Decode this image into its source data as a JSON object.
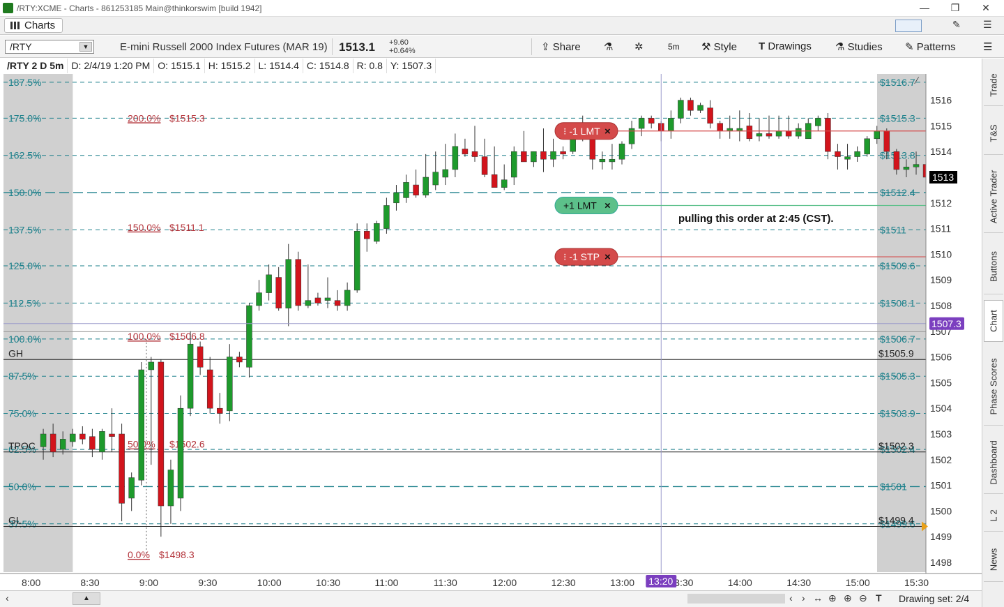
{
  "window": {
    "title": "/RTY:XCME - Charts - 861253185 Main@thinkorswim [build 1942]",
    "minimize": "—",
    "restore": "❐",
    "close": "✕"
  },
  "tabrow": {
    "tab_label": "Charts",
    "pin": "✎",
    "menu": "☰"
  },
  "toolbar": {
    "symbol": "/RTY",
    "description": "E-mini Russell 2000 Index Futures (MAR 19)",
    "last_price": "1513.1",
    "change": "+9.60",
    "change_pct": "+0.64%",
    "share": "Share",
    "aggregation": "5m",
    "style": "Style",
    "drawings": "Drawings",
    "studies": "Studies",
    "patterns": "Patterns"
  },
  "infoline": {
    "symbol": "/RTY 2 D 5m",
    "date": "D: 2/4/19 1:20 PM",
    "open": "O: 1515.1",
    "high": "H: 1515.2",
    "low": "L: 1514.4",
    "close": "C: 1514.8",
    "range": "R: 0.8",
    "ycursor": "Y: 1507.3"
  },
  "sidebar": {
    "tabs": [
      "Trade",
      "T&S",
      "Active Trader",
      "Buttons",
      "Chart",
      "Phase Scores",
      "Dashboard",
      "L 2",
      "News"
    ],
    "active": "Chart"
  },
  "bottombar": {
    "drawing_set": "Drawing set: 2/4"
  },
  "colors": {
    "up": "#1e9a2c",
    "down": "#d2141c",
    "fib": "#1a7f8a",
    "fibtxt": "#b3333a",
    "order_red": "#d44a4a",
    "order_green": "#5cc08a",
    "cursor_badge": "#7b3fbf"
  },
  "chart_data": {
    "type": "candlestick",
    "title": "",
    "x_ticks": [
      "8:00",
      "8:30",
      "9:00",
      "9:30",
      "10:00",
      "10:30",
      "11:00",
      "11:30",
      "12:00",
      "12:30",
      "13:00",
      "13:30",
      "14:00",
      "14:30",
      "15:00",
      "15:30"
    ],
    "y_ticks": [
      1498,
      1499,
      1500,
      1501,
      1502,
      1503,
      1504,
      1505,
      1506,
      1507,
      1508,
      1509,
      1510,
      1511,
      1512,
      1513,
      1514,
      1515,
      1516
    ],
    "ylim": [
      1497.6,
      1516.6
    ],
    "last_price_badge": "1513",
    "cursor_price_badge": "1507.3",
    "cursor_time_badge": "13:20",
    "cursor_time_minutes": 800,
    "cursor_price": 1507.3,
    "candles": [
      {
        "t": 485,
        "o": 1502.5,
        "h": 1503.2,
        "l": 1502.0,
        "c": 1503.0
      },
      {
        "t": 490,
        "o": 1503.0,
        "h": 1503.4,
        "l": 1502.1,
        "c": 1502.3
      },
      {
        "t": 495,
        "o": 1502.4,
        "h": 1503.1,
        "l": 1502.2,
        "c": 1502.8
      },
      {
        "t": 500,
        "o": 1502.7,
        "h": 1503.2,
        "l": 1502.5,
        "c": 1503.0
      },
      {
        "t": 505,
        "o": 1503.0,
        "h": 1503.3,
        "l": 1502.6,
        "c": 1502.8
      },
      {
        "t": 510,
        "o": 1502.9,
        "h": 1503.2,
        "l": 1502.1,
        "c": 1502.4
      },
      {
        "t": 515,
        "o": 1502.3,
        "h": 1503.2,
        "l": 1502.0,
        "c": 1503.1
      },
      {
        "t": 520,
        "o": 1503.0,
        "h": 1504.0,
        "l": 1502.3,
        "c": 1502.9
      },
      {
        "t": 525,
        "o": 1503.0,
        "h": 1503.4,
        "l": 1499.6,
        "c": 1500.3
      },
      {
        "t": 530,
        "o": 1500.5,
        "h": 1501.5,
        "l": 1500.0,
        "c": 1501.3
      },
      {
        "t": 535,
        "o": 1501.2,
        "h": 1505.8,
        "l": 1501.0,
        "c": 1505.5
      },
      {
        "t": 540,
        "o": 1505.5,
        "h": 1506.0,
        "l": 1501.8,
        "c": 1505.8
      },
      {
        "t": 545,
        "o": 1505.8,
        "h": 1505.9,
        "l": 1499.0,
        "c": 1500.2
      },
      {
        "t": 550,
        "o": 1500.2,
        "h": 1502.0,
        "l": 1499.5,
        "c": 1501.6
      },
      {
        "t": 555,
        "o": 1500.5,
        "h": 1504.5,
        "l": 1500.0,
        "c": 1504.0
      },
      {
        "t": 560,
        "o": 1504.0,
        "h": 1507.0,
        "l": 1503.7,
        "c": 1506.5
      },
      {
        "t": 565,
        "o": 1506.4,
        "h": 1506.6,
        "l": 1505.3,
        "c": 1505.6
      },
      {
        "t": 570,
        "o": 1505.5,
        "h": 1506.0,
        "l": 1503.8,
        "c": 1504.0
      },
      {
        "t": 575,
        "o": 1504.0,
        "h": 1504.6,
        "l": 1503.4,
        "c": 1503.8
      },
      {
        "t": 580,
        "o": 1503.9,
        "h": 1506.5,
        "l": 1503.5,
        "c": 1506.0
      },
      {
        "t": 585,
        "o": 1506.0,
        "h": 1506.2,
        "l": 1505.6,
        "c": 1505.8
      },
      {
        "t": 590,
        "o": 1505.6,
        "h": 1508.1,
        "l": 1505.2,
        "c": 1508.0
      },
      {
        "t": 595,
        "o": 1508.0,
        "h": 1509.0,
        "l": 1507.8,
        "c": 1508.5
      },
      {
        "t": 600,
        "o": 1508.5,
        "h": 1509.6,
        "l": 1508.2,
        "c": 1509.2
      },
      {
        "t": 605,
        "o": 1509.1,
        "h": 1509.5,
        "l": 1507.8,
        "c": 1507.9
      },
      {
        "t": 610,
        "o": 1507.9,
        "h": 1510.4,
        "l": 1507.2,
        "c": 1509.8
      },
      {
        "t": 615,
        "o": 1509.8,
        "h": 1510.1,
        "l": 1507.8,
        "c": 1508.0
      },
      {
        "t": 620,
        "o": 1508.0,
        "h": 1509.6,
        "l": 1507.9,
        "c": 1508.2
      },
      {
        "t": 625,
        "o": 1508.3,
        "h": 1508.5,
        "l": 1508.0,
        "c": 1508.1
      },
      {
        "t": 630,
        "o": 1508.2,
        "h": 1509.1,
        "l": 1507.9,
        "c": 1508.3
      },
      {
        "t": 635,
        "o": 1508.2,
        "h": 1508.6,
        "l": 1507.8,
        "c": 1508.0
      },
      {
        "t": 640,
        "o": 1508.0,
        "h": 1508.9,
        "l": 1507.8,
        "c": 1508.6
      },
      {
        "t": 645,
        "o": 1508.6,
        "h": 1511.2,
        "l": 1508.5,
        "c": 1510.9
      },
      {
        "t": 650,
        "o": 1510.9,
        "h": 1511.2,
        "l": 1510.1,
        "c": 1510.6
      },
      {
        "t": 655,
        "o": 1510.5,
        "h": 1511.3,
        "l": 1510.4,
        "c": 1511.2
      },
      {
        "t": 660,
        "o": 1511.0,
        "h": 1512.2,
        "l": 1510.8,
        "c": 1511.9
      },
      {
        "t": 665,
        "o": 1512.0,
        "h": 1512.7,
        "l": 1511.7,
        "c": 1512.4
      },
      {
        "t": 670,
        "o": 1512.2,
        "h": 1513.1,
        "l": 1512.0,
        "c": 1512.8
      },
      {
        "t": 675,
        "o": 1512.7,
        "h": 1513.3,
        "l": 1512.2,
        "c": 1512.3
      },
      {
        "t": 680,
        "o": 1512.3,
        "h": 1513.9,
        "l": 1512.2,
        "c": 1513.0
      },
      {
        "t": 685,
        "o": 1512.7,
        "h": 1514.0,
        "l": 1512.5,
        "c": 1513.2
      },
      {
        "t": 690,
        "o": 1513.0,
        "h": 1514.3,
        "l": 1512.7,
        "c": 1513.3
      },
      {
        "t": 695,
        "o": 1513.3,
        "h": 1514.7,
        "l": 1513.0,
        "c": 1514.2
      },
      {
        "t": 700,
        "o": 1514.1,
        "h": 1514.5,
        "l": 1513.8,
        "c": 1513.9
      },
      {
        "t": 705,
        "o": 1514.0,
        "h": 1515.0,
        "l": 1513.6,
        "c": 1513.8
      },
      {
        "t": 710,
        "o": 1513.8,
        "h": 1514.5,
        "l": 1513.0,
        "c": 1513.1
      },
      {
        "t": 715,
        "o": 1513.1,
        "h": 1514.2,
        "l": 1512.8,
        "c": 1512.6
      },
      {
        "t": 720,
        "o": 1512.6,
        "h": 1513.5,
        "l": 1512.5,
        "c": 1512.9
      },
      {
        "t": 725,
        "o": 1513.0,
        "h": 1514.2,
        "l": 1512.7,
        "c": 1514.0
      },
      {
        "t": 730,
        "o": 1514.0,
        "h": 1514.8,
        "l": 1513.8,
        "c": 1513.6
      },
      {
        "t": 735,
        "o": 1513.6,
        "h": 1514.0,
        "l": 1513.4,
        "c": 1514.0
      },
      {
        "t": 740,
        "o": 1514.0,
        "h": 1514.9,
        "l": 1513.2,
        "c": 1513.7
      },
      {
        "t": 745,
        "o": 1513.7,
        "h": 1514.5,
        "l": 1513.4,
        "c": 1514.0
      },
      {
        "t": 750,
        "o": 1514.0,
        "h": 1514.2,
        "l": 1513.7,
        "c": 1513.9
      },
      {
        "t": 755,
        "o": 1514.0,
        "h": 1515.0,
        "l": 1513.9,
        "c": 1514.8
      },
      {
        "t": 760,
        "o": 1514.9,
        "h": 1515.4,
        "l": 1514.4,
        "c": 1514.7
      },
      {
        "t": 765,
        "o": 1514.8,
        "h": 1515.0,
        "l": 1513.3,
        "c": 1513.7
      },
      {
        "t": 770,
        "o": 1513.6,
        "h": 1514.0,
        "l": 1513.3,
        "c": 1513.7
      },
      {
        "t": 775,
        "o": 1513.6,
        "h": 1514.3,
        "l": 1513.3,
        "c": 1513.7
      },
      {
        "t": 780,
        "o": 1513.7,
        "h": 1514.4,
        "l": 1513.5,
        "c": 1514.3
      },
      {
        "t": 785,
        "o": 1514.3,
        "h": 1515.2,
        "l": 1514.1,
        "c": 1514.9
      },
      {
        "t": 790,
        "o": 1514.9,
        "h": 1515.4,
        "l": 1514.6,
        "c": 1515.3
      },
      {
        "t": 795,
        "o": 1515.3,
        "h": 1515.4,
        "l": 1514.9,
        "c": 1515.1
      },
      {
        "t": 800,
        "o": 1515.1,
        "h": 1515.2,
        "l": 1514.4,
        "c": 1514.8
      },
      {
        "t": 805,
        "o": 1514.8,
        "h": 1515.6,
        "l": 1514.5,
        "c": 1515.3
      },
      {
        "t": 810,
        "o": 1515.3,
        "h": 1516.1,
        "l": 1515.1,
        "c": 1516.0
      },
      {
        "t": 815,
        "o": 1516.0,
        "h": 1516.1,
        "l": 1515.4,
        "c": 1515.6
      },
      {
        "t": 820,
        "o": 1515.6,
        "h": 1515.9,
        "l": 1515.5,
        "c": 1515.8
      },
      {
        "t": 825,
        "o": 1515.7,
        "h": 1516.0,
        "l": 1514.9,
        "c": 1515.1
      },
      {
        "t": 830,
        "o": 1515.1,
        "h": 1515.2,
        "l": 1514.5,
        "c": 1514.8
      },
      {
        "t": 835,
        "o": 1514.8,
        "h": 1515.4,
        "l": 1514.5,
        "c": 1514.9
      },
      {
        "t": 840,
        "o": 1514.8,
        "h": 1515.6,
        "l": 1514.4,
        "c": 1514.9
      },
      {
        "t": 845,
        "o": 1515.0,
        "h": 1515.5,
        "l": 1514.4,
        "c": 1514.5
      },
      {
        "t": 850,
        "o": 1514.6,
        "h": 1515.3,
        "l": 1514.4,
        "c": 1514.7
      },
      {
        "t": 855,
        "o": 1514.7,
        "h": 1515.4,
        "l": 1514.5,
        "c": 1514.6
      },
      {
        "t": 860,
        "o": 1514.6,
        "h": 1515.4,
        "l": 1514.5,
        "c": 1514.8
      },
      {
        "t": 865,
        "o": 1514.8,
        "h": 1515.4,
        "l": 1514.5,
        "c": 1514.6
      },
      {
        "t": 870,
        "o": 1514.6,
        "h": 1515.1,
        "l": 1514.5,
        "c": 1514.9
      },
      {
        "t": 875,
        "o": 1514.5,
        "h": 1515.3,
        "l": 1514.5,
        "c": 1515.1
      },
      {
        "t": 880,
        "o": 1515.0,
        "h": 1515.4,
        "l": 1514.8,
        "c": 1515.3
      },
      {
        "t": 885,
        "o": 1515.3,
        "h": 1515.5,
        "l": 1513.7,
        "c": 1514.0
      },
      {
        "t": 890,
        "o": 1514.0,
        "h": 1514.3,
        "l": 1513.3,
        "c": 1513.8
      },
      {
        "t": 895,
        "o": 1513.7,
        "h": 1514.3,
        "l": 1513.3,
        "c": 1513.8
      },
      {
        "t": 900,
        "o": 1513.8,
        "h": 1514.2,
        "l": 1513.6,
        "c": 1514.0
      },
      {
        "t": 905,
        "o": 1513.9,
        "h": 1514.6,
        "l": 1513.8,
        "c": 1514.5
      },
      {
        "t": 910,
        "o": 1514.5,
        "h": 1515.0,
        "l": 1514.3,
        "c": 1514.8
      },
      {
        "t": 915,
        "o": 1514.8,
        "h": 1514.9,
        "l": 1513.7,
        "c": 1514.0
      },
      {
        "t": 920,
        "o": 1514.0,
        "h": 1514.1,
        "l": 1513.1,
        "c": 1513.3
      },
      {
        "t": 925,
        "o": 1513.3,
        "h": 1513.7,
        "l": 1513.0,
        "c": 1513.4
      },
      {
        "t": 930,
        "o": 1513.4,
        "h": 1514.0,
        "l": 1513.1,
        "c": 1513.5
      },
      {
        "t": 935,
        "o": 1513.5,
        "h": 1513.7,
        "l": 1512.9,
        "c": 1513.0
      }
    ],
    "fib_levels": [
      {
        "pct": "175.0%",
        "price": "$1515.3",
        "v": 1515.3
      },
      {
        "pct": "162.5%",
        "price": "$1513.8",
        "v": 1513.85
      },
      {
        "pct": "150.0%",
        "price": "$1512.4",
        "v": 1512.4
      },
      {
        "pct": "137.5%",
        "price": "$1511",
        "v": 1510.95
      },
      {
        "pct": "125.0%",
        "price": "$1509.6",
        "v": 1509.55
      },
      {
        "pct": "112.5%",
        "price": "$1508.1",
        "v": 1508.1
      },
      {
        "pct": "100.0%",
        "price": "$1506.7",
        "v": 1506.7
      },
      {
        "pct": "87.5%",
        "price": "$1505.3",
        "v": 1505.25
      },
      {
        "pct": "75.0%",
        "price": "$1503.9",
        "v": 1503.8
      },
      {
        "pct": "62.5%",
        "price": "$1502.4",
        "v": 1502.4
      },
      {
        "pct": "50.0%",
        "price": "$1501",
        "v": 1500.95
      },
      {
        "pct": "37.5%",
        "price": "$1499.6",
        "v": 1499.5
      }
    ],
    "fib_top": {
      "pct": "187.5%",
      "price": "$1516.7"
    },
    "fib_labels": [
      {
        "pct": "200.0%",
        "price": "$1515.3",
        "v": 1515.3
      },
      {
        "pct": "150.0%",
        "price": "$1511.1",
        "v": 1511.05
      },
      {
        "pct": "100.0%",
        "price": "$1506.8",
        "v": 1506.8
      },
      {
        "pct": "50.0%",
        "price": "$1502.6",
        "v": 1502.6
      },
      {
        "pct": "0.0%",
        "price": "$1498.3",
        "v": 1498.3
      }
    ],
    "solid_levels": [
      {
        "label": "GH",
        "price": "$1505.9",
        "v": 1505.9
      },
      {
        "label": "TPOC",
        "price": "$1502.3",
        "v": 1502.3
      },
      {
        "label": "GL",
        "price": "$1499.4",
        "v": 1499.4
      }
    ],
    "orders": [
      {
        "label": "-1 LMT",
        "v": 1514.8,
        "kind": "sell"
      },
      {
        "label": "+1 LMT",
        "v": 1511.9,
        "kind": "buy"
      },
      {
        "label": "-1 STP",
        "v": 1509.9,
        "kind": "sell"
      }
    ],
    "note": "pulling this order at 2:45 (CST)."
  }
}
